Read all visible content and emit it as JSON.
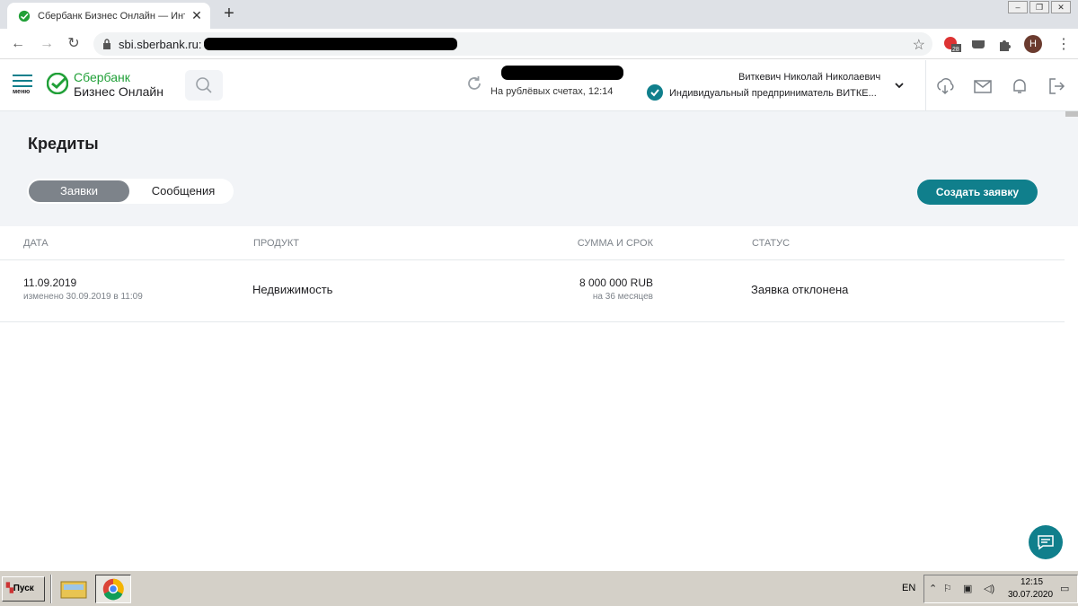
{
  "browser": {
    "tab_title": "Сбербанк Бизнес Онлайн — Интер",
    "url": "sbi.sberbank.ru:",
    "ext_badge": "28",
    "profile_initial": "Н"
  },
  "header": {
    "menu_label": "меню",
    "logo_line1": "Сбербанк",
    "logo_line2": "Бизнес Онлайн",
    "balance_note": "На рублёвых счетах, 12:14",
    "user_name": "Виткевич Николай Николаевич",
    "org_name": "Индивидуальный предприниматель ВИТКЕ..."
  },
  "page": {
    "title": "Кредиты",
    "tabs": [
      {
        "label": "Заявки",
        "active": true
      },
      {
        "label": "Сообщения",
        "active": false
      }
    ],
    "create_button": "Создать заявку"
  },
  "table": {
    "columns": [
      "ДАТА",
      "ПРОДУКТ",
      "СУММА И СРОК",
      "СТАТУС"
    ],
    "rows": [
      {
        "date": "11.09.2019",
        "modified": "изменено 30.09.2019 в 11:09",
        "product": "Недвижимость",
        "amount": "8 000 000 RUB",
        "term": "на 36 месяцев",
        "status": "Заявка отклонена"
      }
    ]
  },
  "taskbar": {
    "start_label": "Пуск",
    "lang": "EN",
    "time": "12:15",
    "date": "30.07.2020"
  },
  "colors": {
    "accent": "#107f8c",
    "brand_green": "#21a038",
    "page_bg": "#f2f4f7"
  }
}
